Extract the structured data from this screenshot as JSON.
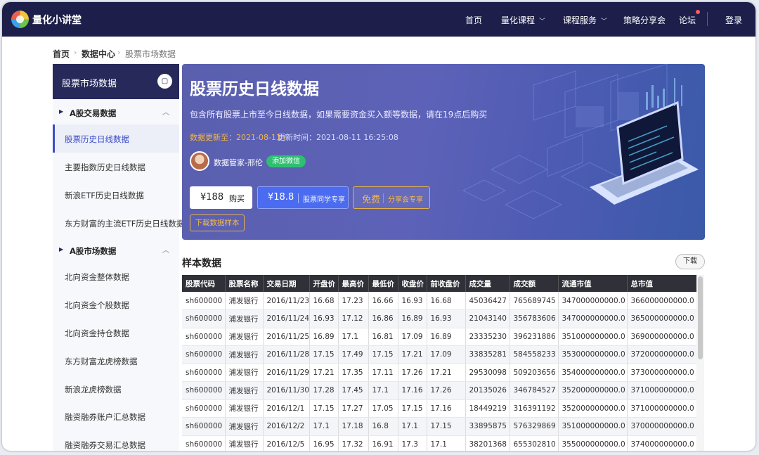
{
  "nav": {
    "brand": "量化小讲堂",
    "items": [
      {
        "label": "首页",
        "dropdown": false
      },
      {
        "label": "量化课程",
        "dropdown": true
      },
      {
        "label": "课程服务",
        "dropdown": true
      },
      {
        "label": "策略分享会",
        "dropdown": false
      },
      {
        "label": "论坛",
        "dropdown": false
      }
    ],
    "login": "登录"
  },
  "breadcrumb": [
    "首页",
    "数据中心",
    "股票市场数据"
  ],
  "sidebar": {
    "title": "股票市场数据",
    "sections": [
      {
        "label": "A股交易数据",
        "items": [
          "股票历史日线数据",
          "主要指数历史日线数据",
          "新浪ETF历史日线数据",
          "东方财富的主流ETF历史日线数据"
        ]
      },
      {
        "label": "A股市场数据",
        "items": [
          "北向资金整体数据",
          "北向资金个股数据",
          "北向资金持仓数据",
          "东方财富龙虎榜数据",
          "新浪龙虎榜数据",
          "融资融券账户汇总数据",
          "融资融券交易汇总数据"
        ]
      }
    ],
    "active_item": "股票历史日线数据"
  },
  "hero": {
    "title": "股票历史日线数据",
    "desc": "包含所有股票上市至今日线数据，如果需要资金买入额等数据，请在19点后购买",
    "update_label": "数据更新至：2021-08-11 / ",
    "update_time": "更新时间：2021-08-11 16:25:08",
    "manager": "数据管家-邢伦",
    "wechat_button": "添加微信",
    "price1": "¥188",
    "price1_action": "购买",
    "price2": "¥18.8",
    "price2_note": "股票同学专享",
    "price3": "免费",
    "price3_note": "分享会专享",
    "download_sample": "下载数据样本"
  },
  "sample": {
    "title": "样本数据",
    "download": "下载",
    "columns": [
      "股票代码",
      "股票名称",
      "交易日期",
      "开盘价",
      "最高价",
      "最低价",
      "收盘价",
      "前收盘价",
      "成交量",
      "成交额",
      "流通市值",
      "总市值"
    ],
    "rows": [
      [
        "sh600000",
        "浦发银行",
        "2016/11/23",
        "16.68",
        "17.23",
        "16.66",
        "16.93",
        "16.68",
        "45036427",
        "765689745",
        "347000000000.0",
        "366000000000.0"
      ],
      [
        "sh600000",
        "浦发银行",
        "2016/11/24",
        "16.93",
        "17.12",
        "16.86",
        "16.89",
        "16.93",
        "21043140",
        "356783606",
        "347000000000.0",
        "365000000000.0"
      ],
      [
        "sh600000",
        "浦发银行",
        "2016/11/25",
        "16.89",
        "17.1",
        "16.81",
        "17.09",
        "16.89",
        "23335230",
        "396231886",
        "351000000000.0",
        "369000000000.0"
      ],
      [
        "sh600000",
        "浦发银行",
        "2016/11/28",
        "17.15",
        "17.49",
        "17.15",
        "17.21",
        "17.09",
        "33835281",
        "584558233",
        "353000000000.0",
        "372000000000.0"
      ],
      [
        "sh600000",
        "浦发银行",
        "2016/11/29",
        "17.21",
        "17.35",
        "17.11",
        "17.26",
        "17.21",
        "29530098",
        "509203656",
        "354000000000.0",
        "373000000000.0"
      ],
      [
        "sh600000",
        "浦发银行",
        "2016/11/30",
        "17.28",
        "17.45",
        "17.1",
        "17.16",
        "17.26",
        "20135026",
        "346784527",
        "352000000000.0",
        "371000000000.0"
      ],
      [
        "sh600000",
        "浦发银行",
        "2016/12/1",
        "17.15",
        "17.27",
        "17.05",
        "17.15",
        "17.16",
        "18449219",
        "316391192",
        "352000000000.0",
        "371000000000.0"
      ],
      [
        "sh600000",
        "浦发银行",
        "2016/12/2",
        "17.1",
        "17.18",
        "16.8",
        "17.1",
        "17.15",
        "33895875",
        "576329869",
        "351000000000.0",
        "370000000000.0"
      ],
      [
        "sh600000",
        "浦发银行",
        "2016/12/5",
        "16.95",
        "17.32",
        "16.91",
        "17.3",
        "17.1",
        "38201368",
        "655302810",
        "355000000000.0",
        "374000000000.0"
      ]
    ]
  }
}
